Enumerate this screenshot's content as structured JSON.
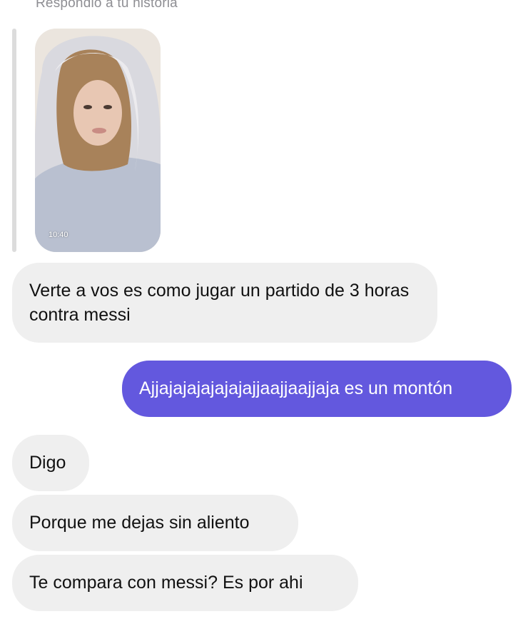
{
  "reply_label": "Respondió a tu historia",
  "story": {
    "time": "10:40",
    "image": "portrait-hoodie"
  },
  "messages": [
    {
      "from": "them",
      "text": "Verte a vos es como jugar un partido de 3 horas contra messi"
    },
    {
      "from": "me",
      "text": "Ajjajajajajajajajjaajjaajjaja es un montón"
    },
    {
      "from": "them",
      "text": "Digo"
    },
    {
      "from": "them",
      "text": "Porque me dejas sin aliento"
    },
    {
      "from": "them",
      "text": "Te compara con messi? Es por ahi"
    }
  ],
  "colors": {
    "incoming_bubble": "#efefef",
    "outgoing_bubble": "#6358de",
    "muted_text": "#8e8e93"
  }
}
